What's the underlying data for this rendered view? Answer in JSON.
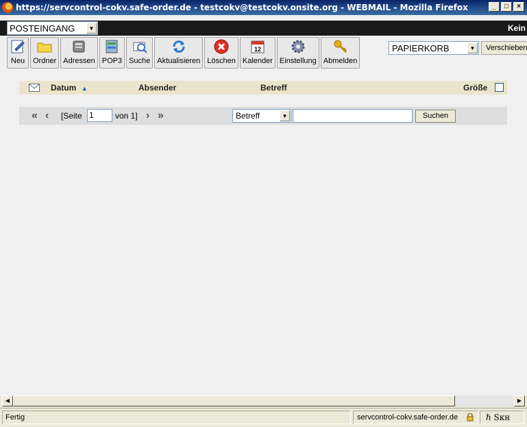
{
  "window": {
    "title": "https://servcontrol-cokv.safe-order.de - testcokv@testcokv.onsite.org - WEBMAIL - Mozilla Firefox",
    "minimize": "_",
    "maximize": "□",
    "close": "×"
  },
  "folderbar": {
    "folder_selected": "POSTEINGANG",
    "right_text": "Kein"
  },
  "toolbar": {
    "buttons": [
      {
        "label": "Neu",
        "icon": "compose-icon"
      },
      {
        "label": "Ordner",
        "icon": "folder-icon"
      },
      {
        "label": "Adressen",
        "icon": "address-book-icon"
      },
      {
        "label": "POP3",
        "icon": "server-icon"
      },
      {
        "label": "Suche",
        "icon": "search-mail-icon"
      },
      {
        "label": "Aktualisieren",
        "icon": "refresh-icon"
      },
      {
        "label": "Löschen",
        "icon": "delete-icon"
      },
      {
        "label": "Kalender",
        "icon": "calendar-icon"
      },
      {
        "label": "Einstellung",
        "icon": "gear-icon"
      },
      {
        "label": "Abmelden",
        "icon": "key-icon"
      }
    ],
    "calendar_day": "12",
    "trash_selected": "PAPIERKORB",
    "move_label": "Verschieben"
  },
  "table": {
    "headers": {
      "datum": "Datum",
      "absender": "Absender",
      "betreff": "Betreff",
      "groesse": "Größe"
    },
    "sort_indicator": "▲"
  },
  "pager": {
    "first": "«",
    "prev": "‹",
    "seite_label": "[Seite",
    "page_value": "1",
    "von_label": "von 1]",
    "next": "›",
    "last": "»",
    "field_selected": "Betreff",
    "search_value": "",
    "search_label": "Suchen"
  },
  "statusbar": {
    "status": "Fertig",
    "host": "servcontrol-cokv.safe-order.de",
    "extra": "ℏ Sкʜ"
  }
}
